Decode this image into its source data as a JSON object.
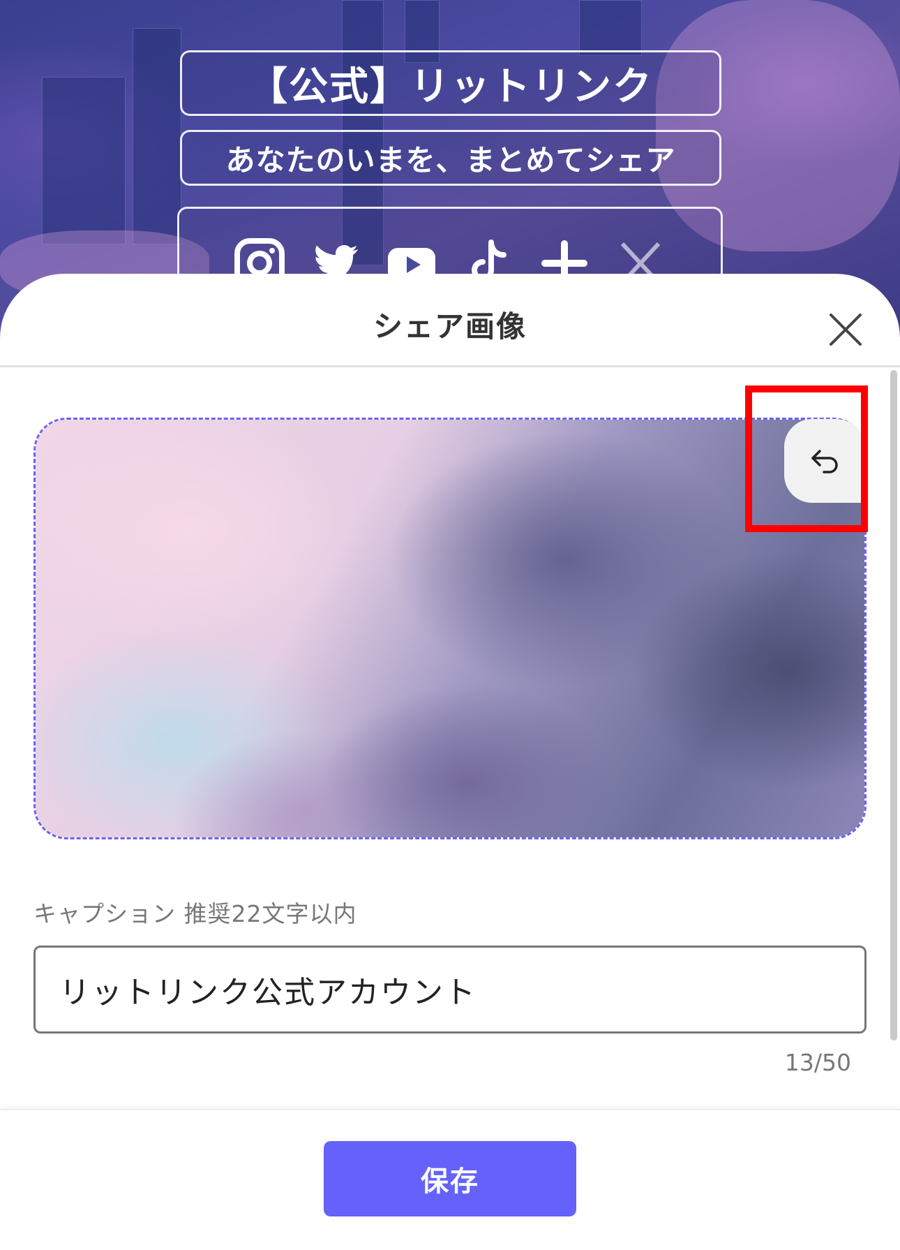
{
  "profile": {
    "title": "【公式】リットリンク",
    "tagline": "あなたのいまを、まとめてシェア",
    "social_icons": [
      "instagram-icon",
      "twitter-icon",
      "youtube-icon",
      "tiktok-icon",
      "plus-icon",
      "x-icon"
    ]
  },
  "sheet": {
    "title": "シェア画像",
    "close_icon": "close-icon",
    "undo_icon": "undo-icon",
    "caption": {
      "label": "キャプション 推奨22文字以内",
      "value": "リットリンク公式アカウント",
      "count": "13/50"
    },
    "save_label": "保存"
  },
  "colors": {
    "accent": "#6562fb",
    "dashed_border": "#6b62f0",
    "highlight": "#ff0000"
  }
}
